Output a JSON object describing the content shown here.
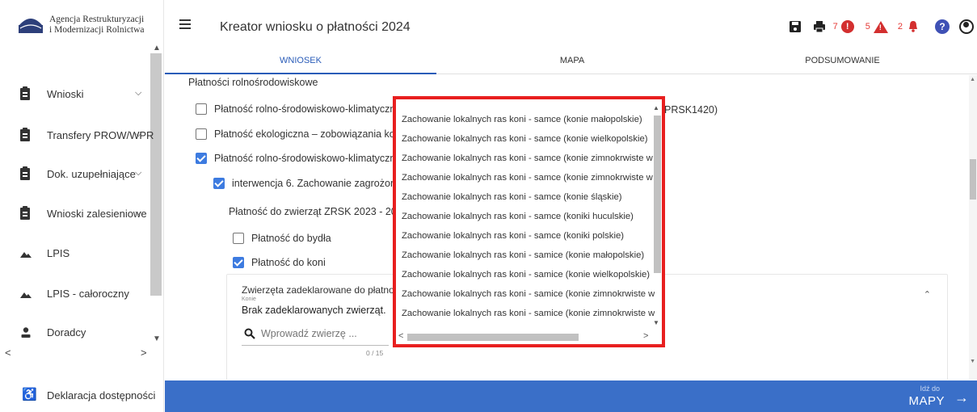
{
  "sidebar": {
    "agency_line1": "Agencja Restrukturyzacji",
    "agency_line2": "i Modernizacji Rolnictwa",
    "logo_text": "ARiMR",
    "items": [
      {
        "label": "Wnioski",
        "icon": "clipboard-icon",
        "chevron": "⌄"
      },
      {
        "label": "Transfery PROW/WPR",
        "icon": "clipboard-icon",
        "chevron": "⌄"
      },
      {
        "label": "Dok. uzupełniające",
        "icon": "clipboard-icon",
        "chevron": "⌄"
      },
      {
        "label": "Wnioski zalesieniowe",
        "icon": "clipboard-icon",
        "chevron": "⌄"
      },
      {
        "label": "LPIS",
        "icon": "mountain-icon"
      },
      {
        "label": "LPIS - całoroczny",
        "icon": "mountain-icon"
      },
      {
        "label": "Doradcy",
        "icon": "person-icon"
      }
    ],
    "accessibility_label": "Deklaracja dostępności"
  },
  "header": {
    "title": "Kreator wniosku o płatności 2024",
    "error_count": "7",
    "warning_count": "5",
    "notification_count": "2",
    "accent_color": "#2a5cb8",
    "alert_color": "#d32f2f"
  },
  "tabs": [
    {
      "label": "WNIOSEK",
      "active": true
    },
    {
      "label": "MAPA",
      "active": false
    },
    {
      "label": "PODSUMOWANIE",
      "active": false
    }
  ],
  "content": {
    "section_title": "Płatności rolnośrodowiskowe",
    "rows": [
      {
        "label": "Płatność rolno-środowiskowo-klimatyczn",
        "checked": false
      },
      {
        "label": "Płatność ekologiczna – zobowiązania ko",
        "checked": false
      },
      {
        "label": "Płatność rolno-środowiskowo-klimatyczn",
        "checked": true
      }
    ],
    "row1_suffix": "PRSK1420)",
    "intervention_label": "interwencja 6. Zachowanie zagrożon",
    "zrsk_label": "Płatność do zwierząt ZRSK 2023 - 202",
    "cattle_label": "Płatność do bydła",
    "horses_label": "Płatność do koni",
    "panel": {
      "title": "Zwierzęta zadeklarowane do płatnoś",
      "subtitle": "Konie",
      "empty": "Brak zadeklarowanych zwierząt.",
      "search_placeholder": "Wprowadź zwierzę ...",
      "counter": "0 / 15"
    }
  },
  "dropdown": {
    "options": [
      "Zachowanie lokalnych ras koni - samce (konie małopolskie)",
      "Zachowanie lokalnych ras koni - samce (konie wielkopolskie)",
      "Zachowanie lokalnych ras koni - samce (konie zimnokrwiste w",
      "Zachowanie lokalnych ras koni - samce (konie zimnokrwiste w",
      "Zachowanie lokalnych ras koni - samce (konie śląskie)",
      "Zachowanie lokalnych ras koni - samce (koniki huculskie)",
      "Zachowanie lokalnych ras koni - samce (koniki polskie)",
      "Zachowanie lokalnych ras koni - samice (konie małopolskie)",
      "Zachowanie lokalnych ras koni - samice (konie wielkopolskie)",
      "Zachowanie lokalnych ras koni - samice (konie zimnokrwiste w",
      "Zachowanie lokalnych ras koni - samice (konie zimnokrwiste w"
    ],
    "highlight_color": "#e81f1f"
  },
  "footer": {
    "goto_small": "Idź do",
    "goto_big": "MAPY"
  }
}
